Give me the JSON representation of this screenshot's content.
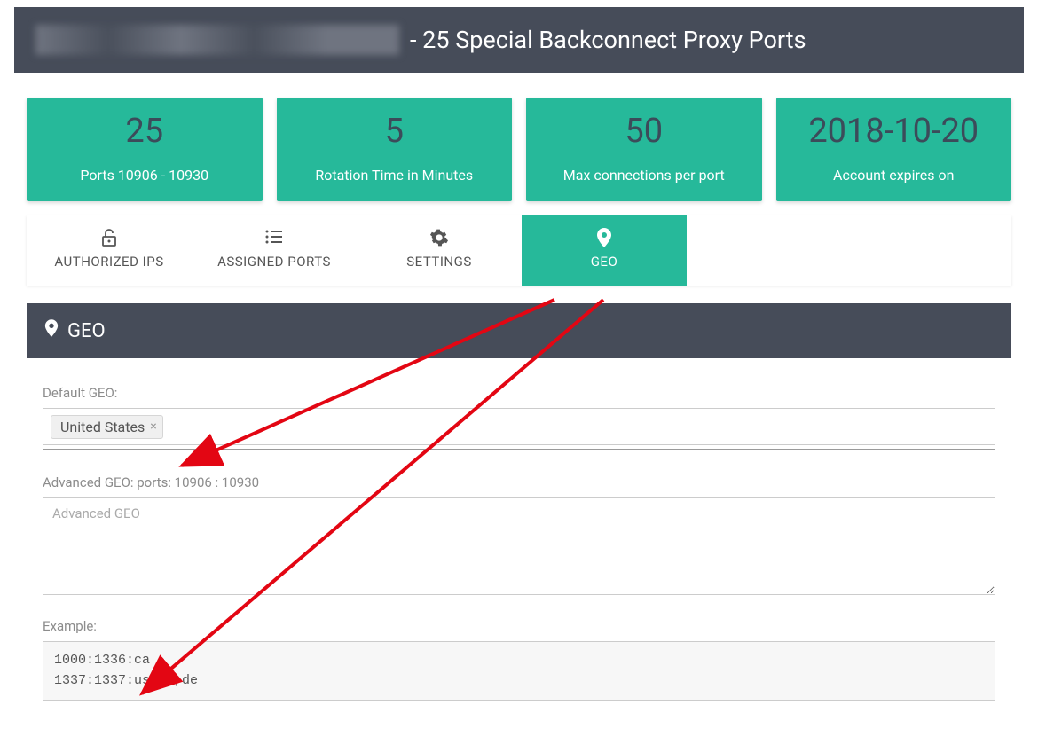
{
  "header": {
    "obscured_prefix": "██████████████████",
    "title_suffix": " - 25 Special Backconnect Proxy Ports"
  },
  "stats": [
    {
      "value": "25",
      "label": "Ports 10906 - 10930"
    },
    {
      "value": "5",
      "label": "Rotation Time in Minutes"
    },
    {
      "value": "50",
      "label": "Max connections per port"
    },
    {
      "value": "2018-10-20",
      "label": "Account expires on"
    }
  ],
  "tabs": {
    "authorized_ips": "AUTHORIZED IPS",
    "assigned_ports": "ASSIGNED PORTS",
    "settings": "SETTINGS",
    "geo": "GEO"
  },
  "panel": {
    "title": "GEO",
    "default_geo_label": "Default GEO:",
    "default_geo_tag": "United States",
    "advanced_label": "Advanced GEO: ports: 10906 : 10930",
    "advanced_placeholder": "Advanced GEO",
    "example_label": "Example:",
    "example_text": "1000:1336:ca\n1337:1337:us,ca,de"
  }
}
